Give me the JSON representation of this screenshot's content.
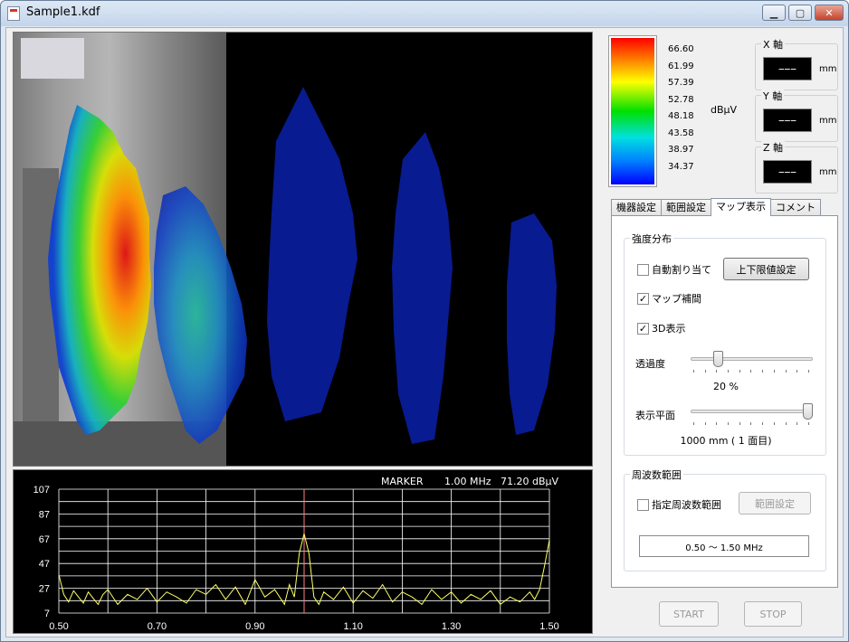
{
  "window": {
    "title": "Sample1.kdf",
    "min_label": "▁",
    "max_label": "▢",
    "close_label": "✕"
  },
  "colorbar": {
    "labels": [
      "66.60",
      "61.99",
      "57.39",
      "52.78",
      "48.18",
      "43.58",
      "38.97",
      "34.37"
    ],
    "unit": "dBμV"
  },
  "axes": [
    {
      "label": "X 軸",
      "value": "−−−",
      "unit": "mm"
    },
    {
      "label": "Y 軸",
      "value": "−−−",
      "unit": "mm"
    },
    {
      "label": "Z 軸",
      "value": "−−−",
      "unit": "mm"
    }
  ],
  "tabs": [
    "機器設定",
    "範囲設定",
    "マップ表示",
    "コメント"
  ],
  "intensity": {
    "group_title": "強度分布",
    "auto_assign": {
      "label": "自動割り当て",
      "checked": false
    },
    "limit_button": "上下限値設定",
    "map_interp": {
      "label": "マップ補間",
      "checked": true
    },
    "display3d": {
      "label": "3D表示",
      "checked": true
    },
    "transparency_label": "透過度",
    "transparency_value": "20 %",
    "transparency_fraction": 0.2,
    "plane_label": "表示平面",
    "plane_value": "1000 mm ( 1 面目)",
    "plane_fraction": 1.0
  },
  "frequency": {
    "group_title": "周波数範囲",
    "specified": {
      "label": "指定周波数範囲",
      "checked": false
    },
    "range_button": "範囲設定",
    "range_text": "0.50 ～ 1.50 MHz"
  },
  "buttons": {
    "start": "START",
    "stop": "STOP"
  },
  "marker": {
    "label": "MARKER",
    "freq": "1.00 MHz",
    "level": "71.20 dBµV"
  },
  "colors": {
    "trace": "#ffff66",
    "marker": "#ff8080",
    "grid": "#ffffff"
  },
  "chart_data": {
    "type": "line",
    "xlim": [
      0.5,
      1.5
    ],
    "ylim": [
      7,
      107
    ],
    "x_ticks": [
      "0.50",
      "0.70",
      "0.90",
      "1.10",
      "1.30",
      "1.50"
    ],
    "y_ticks": [
      "107",
      "87",
      "67",
      "47",
      "27",
      "7"
    ],
    "marker_x": 1.0,
    "series": [
      {
        "x": [
          0.5,
          0.51,
          0.52,
          0.53,
          0.54,
          0.55,
          0.56,
          0.57,
          0.58,
          0.59,
          0.6,
          0.62,
          0.64,
          0.66,
          0.68,
          0.7,
          0.72,
          0.74,
          0.76,
          0.78,
          0.8,
          0.82,
          0.84,
          0.86,
          0.88,
          0.9,
          0.92,
          0.94,
          0.96,
          0.97,
          0.98,
          0.99,
          1.0,
          1.01,
          1.02,
          1.03,
          1.04,
          1.06,
          1.08,
          1.1,
          1.12,
          1.14,
          1.16,
          1.18,
          1.2,
          1.22,
          1.24,
          1.26,
          1.28,
          1.3,
          1.32,
          1.34,
          1.36,
          1.38,
          1.4,
          1.42,
          1.44,
          1.46,
          1.47,
          1.48,
          1.49,
          1.5
        ],
        "y": [
          38,
          22,
          16,
          25,
          20,
          15,
          24,
          19,
          14,
          22,
          26,
          14,
          22,
          18,
          27,
          16,
          24,
          20,
          15,
          26,
          22,
          30,
          18,
          28,
          14,
          34,
          20,
          26,
          14,
          30,
          20,
          55,
          71,
          55,
          20,
          14,
          24,
          18,
          28,
          15,
          25,
          19,
          30,
          16,
          24,
          20,
          14,
          26,
          18,
          24,
          15,
          22,
          18,
          25,
          14,
          20,
          16,
          24,
          18,
          26,
          45,
          66
        ]
      }
    ]
  }
}
